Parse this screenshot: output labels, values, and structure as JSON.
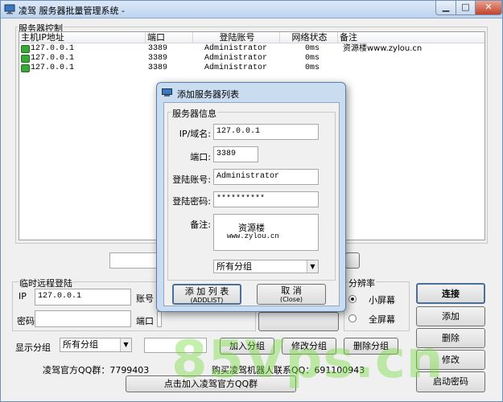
{
  "window": {
    "title": "凌驾 服务器批量管理系统  -"
  },
  "server_panel": {
    "title": "服务器控制",
    "columns": [
      "主机IP地址",
      "端口",
      "登陆账号",
      "网络状态",
      "备注"
    ],
    "rows": [
      {
        "ip": "127.0.0.1",
        "port": "3389",
        "account": "Administrator",
        "status": "0ms",
        "note": "资源楼www.zylou.cn"
      },
      {
        "ip": "127.0.0.1",
        "port": "3389",
        "account": "Administrator",
        "status": "0ms",
        "note": ""
      },
      {
        "ip": "127.0.0.1",
        "port": "3389",
        "account": "Administrator",
        "status": "0ms",
        "note": ""
      }
    ]
  },
  "remote_login": {
    "title": "临时远程登陆",
    "ip_label": "IP",
    "ip_value": "127.0.0.1",
    "account_label": "账号",
    "password_label": "密码",
    "port_label": "端口"
  },
  "resolution": {
    "title": "分辨率",
    "small_label": "小屏幕",
    "full_label": "全屏幕",
    "selected": "small"
  },
  "group_bar": {
    "show_label": "显示分组",
    "group_select": "所有分组",
    "add_group": "加入分组",
    "edit_group": "修改分组",
    "delete_group": "删除分组"
  },
  "footer": {
    "qq_group": "凌驾官方QQ群：7799403",
    "buy_text": "购买凌驾机器人联系QQ：691100943",
    "join_button": "点击加入凌驾官方QQ群"
  },
  "side_buttons": [
    "连接",
    "添加",
    "删除",
    "修改",
    "启动密码"
  ],
  "dialog": {
    "title": "添加服务器列表",
    "group_title": "服务器信息",
    "ip_label": "IP/域名:",
    "ip_value": "127.0.0.1",
    "port_label": "端口:",
    "port_value": "3389",
    "account_label": "登陆账号:",
    "account_value": "Administrator",
    "password_label": "登陆密码:",
    "password_value": "**********",
    "note_label": "备注:",
    "note_line1": "资源楼",
    "note_line2": "www.zylou.cn",
    "group_select": "所有分组",
    "add_button_line1": "添 加 列 表",
    "add_button_line2": "(ADDLIST)",
    "cancel_button_line1": "取 消",
    "cancel_button_line2": "(Close)"
  },
  "watermark": "85Vps.cn",
  "colors": {
    "titlebar": "#bcd3ee",
    "online": "#3ca63c",
    "dialog_frame": "#c9dcf0"
  }
}
